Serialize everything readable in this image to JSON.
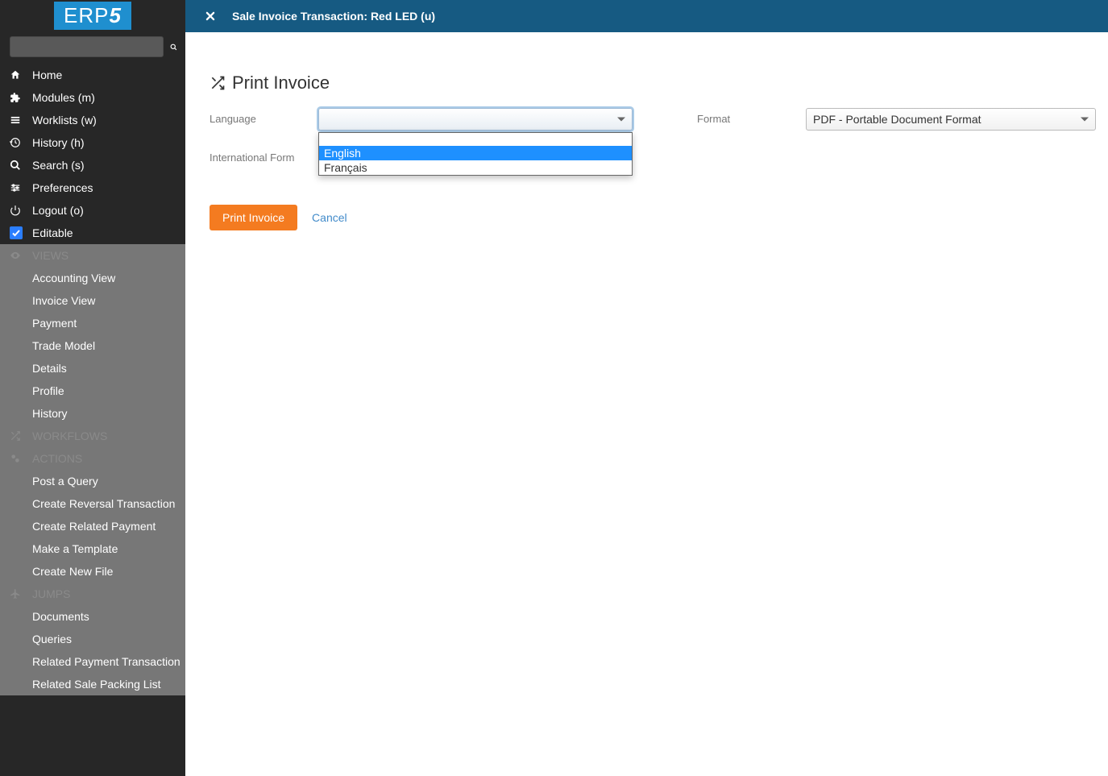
{
  "logo": {
    "text_a": "ERP",
    "text_b": "5"
  },
  "sidebar": {
    "nav": [
      {
        "label": "Home"
      },
      {
        "label": "Modules (m)"
      },
      {
        "label": "Worklists (w)"
      },
      {
        "label": "History (h)"
      },
      {
        "label": "Search (s)"
      },
      {
        "label": "Preferences"
      },
      {
        "label": "Logout (o)"
      }
    ],
    "editable_label": "Editable",
    "views_header": "VIEWS",
    "views": [
      "Accounting View",
      "Invoice View",
      "Payment",
      "Trade Model",
      "Details",
      "Profile",
      "History"
    ],
    "workflows_header": "WORKFLOWS",
    "actions_header": "ACTIONS",
    "actions": [
      "Post a Query",
      "Create Reversal Transaction",
      "Create Related Payment",
      "Make a Template",
      "Create New File"
    ],
    "jumps_header": "JUMPS",
    "jumps": [
      "Documents",
      "Queries",
      "Related Payment Transaction",
      "Related Sale Packing List"
    ]
  },
  "topbar": {
    "title": "Sale Invoice Transaction: Red LED (u)"
  },
  "page": {
    "title": "Print Invoice",
    "labels": {
      "language": "Language",
      "format": "Format",
      "international": "International Form"
    },
    "language_options": {
      "blank": "",
      "english": "English",
      "francais": "Français"
    },
    "format_selected": "PDF - Portable Document Format",
    "buttons": {
      "print": "Print Invoice",
      "cancel": "Cancel"
    }
  }
}
